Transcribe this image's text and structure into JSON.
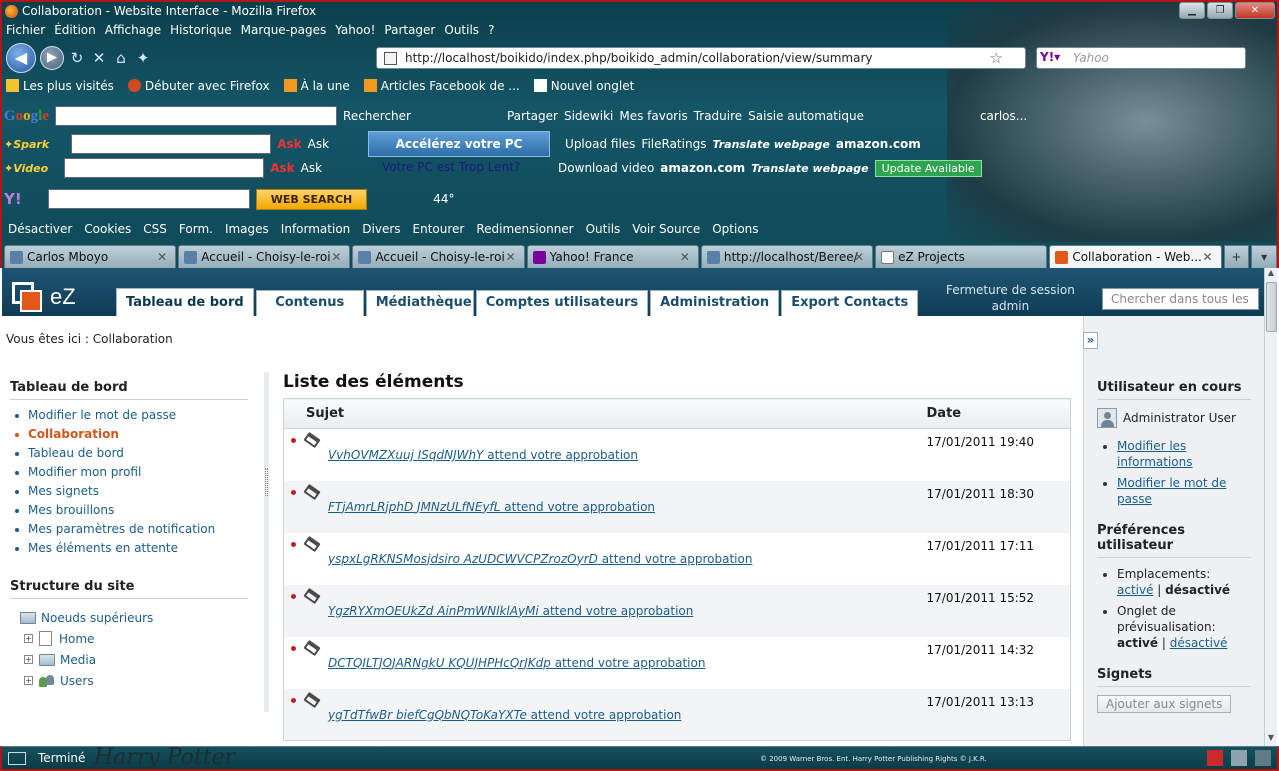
{
  "window": {
    "title": "Collaboration - Website Interface - Mozilla Firefox"
  },
  "menu": [
    "Fichier",
    "Édition",
    "Affichage",
    "Historique",
    "Marque-pages",
    "Yahoo!",
    "Partager",
    "Outils",
    "?"
  ],
  "navbar": {
    "url": "http://localhost/boikido/index.php/boikido_admin/collaboration/view/summary",
    "search_placeholder": "Yahoo"
  },
  "bookmarks": [
    "Les plus visités",
    "Débuter avec Firefox",
    "À la une",
    "Articles Facebook de ...",
    "Nouvel onglet"
  ],
  "toolbars": {
    "google_label": "Google",
    "google_items": [
      "Rechercher",
      "Partager",
      "Sidewiki",
      "Mes favoris",
      "Traduire",
      "Saisie automatique",
      "carlos..."
    ],
    "spark_label": "Ask",
    "accelerate": "Accélérez votre PC",
    "pc_slow": "Votre PC est Trop Lent?",
    "upload_files": "Upload files",
    "file_ratings": "FileRatings",
    "translate_webpage": "Translate webpage",
    "download_video": "Download video",
    "amazon": "amazon.com",
    "update_available": "Update Available",
    "web_search": "WEB SEARCH",
    "temperature": "44°"
  },
  "webdev_bar": [
    "Désactiver",
    "Cookies",
    "CSS",
    "Form.",
    "Images",
    "Information",
    "Divers",
    "Entourer",
    "Redimensionner",
    "Outils",
    "Voir Source",
    "Options"
  ],
  "tabs": [
    {
      "label": "Carlos Mboyo",
      "active": false
    },
    {
      "label": "Accueil - Choisy-le-roi",
      "active": false
    },
    {
      "label": "Accueil - Choisy-le-roi",
      "active": false
    },
    {
      "label": "Yahoo! France",
      "active": false
    },
    {
      "label": "http://localhost/Beree/",
      "active": false
    },
    {
      "label": "eZ Projects",
      "active": false
    },
    {
      "label": "Collaboration - Web...",
      "active": true
    }
  ],
  "ez": {
    "brand": "eZ",
    "tabs": [
      "Tableau de bord",
      "Contenus",
      "Médiathèque",
      "Comptes utilisateurs",
      "Administration",
      "Export Contacts"
    ],
    "logout_line1": "Fermeture de session",
    "logout_line2": "admin",
    "search_placeholder": "Chercher dans tous les",
    "breadcrumb": "Vous êtes ici : Collaboration"
  },
  "left": {
    "dashboard_title": "Tableau de bord",
    "dashboard_items": [
      "Modifier le mot de passe",
      "Collaboration",
      "Tableau de bord",
      "Modifier mon profil",
      "Mes signets",
      "Mes brouillons",
      "Mes paramètres de notification",
      "Mes éléments en attente"
    ],
    "structure_title": "Structure du site",
    "tree_root": "Noeuds supérieurs",
    "tree_items": [
      "Home",
      "Media",
      "Users"
    ]
  },
  "main": {
    "title": "Liste des éléments",
    "col_subject": "Sujet",
    "col_date": "Date",
    "rows": [
      {
        "code": "VvhOVMZXuuj ISqdNJWhY",
        "suffix": " attend votre approbation",
        "date": "17/01/2011 19:40"
      },
      {
        "code": "FTjAmrLRjphD JMNzULfNEyfL",
        "suffix": " attend votre approbation",
        "date": "17/01/2011 18:30"
      },
      {
        "code": "yspxLgRKNSMosjdsiro AzUDCWVCPZrozOyrD",
        "suffix": " attend votre approbation",
        "date": "17/01/2011 17:11"
      },
      {
        "code": "YgzRYXmOEUkZd AinPmWNlklAyMi",
        "suffix": " attend votre approbation",
        "date": "17/01/2011 15:52"
      },
      {
        "code": "DCTQILTJOJARNgkU KQUJHPHcQrJKdp",
        "suffix": " attend votre approbation",
        "date": "17/01/2011 14:32"
      },
      {
        "code": "ygTdTfwBr biefCgQbNQToKaYXTe",
        "suffix": " attend votre approbation",
        "date": "17/01/2011 13:13"
      }
    ]
  },
  "right": {
    "collapse": "»",
    "current_user_title": "Utilisateur en cours",
    "user_name": "Administrator User",
    "user_links": [
      "Modifier les informations",
      "Modifier le mot de passe"
    ],
    "prefs_title": "Préférences utilisateur",
    "pref1_label": "Emplacements:",
    "pref1_on": "activé",
    "pref1_sep": " | ",
    "pref1_off": "désactivé",
    "pref2_label": "Onglet de prévisualisation:",
    "pref2_on": "activé",
    "pref2_sep": " | ",
    "pref2_off": "désactivé",
    "bookmarks_title": "Signets",
    "bookmarks_button": "Ajouter aux signets"
  },
  "status": {
    "text": "Terminé",
    "copyright": "© 2009 Warner Bros. Ent. Harry Potter Publishing Rights © J.K.R."
  },
  "colors": {
    "ez_header": "#1e5573",
    "link": "#1b5d8a",
    "current": "#d2571c",
    "chrome_border": "#b01616"
  }
}
